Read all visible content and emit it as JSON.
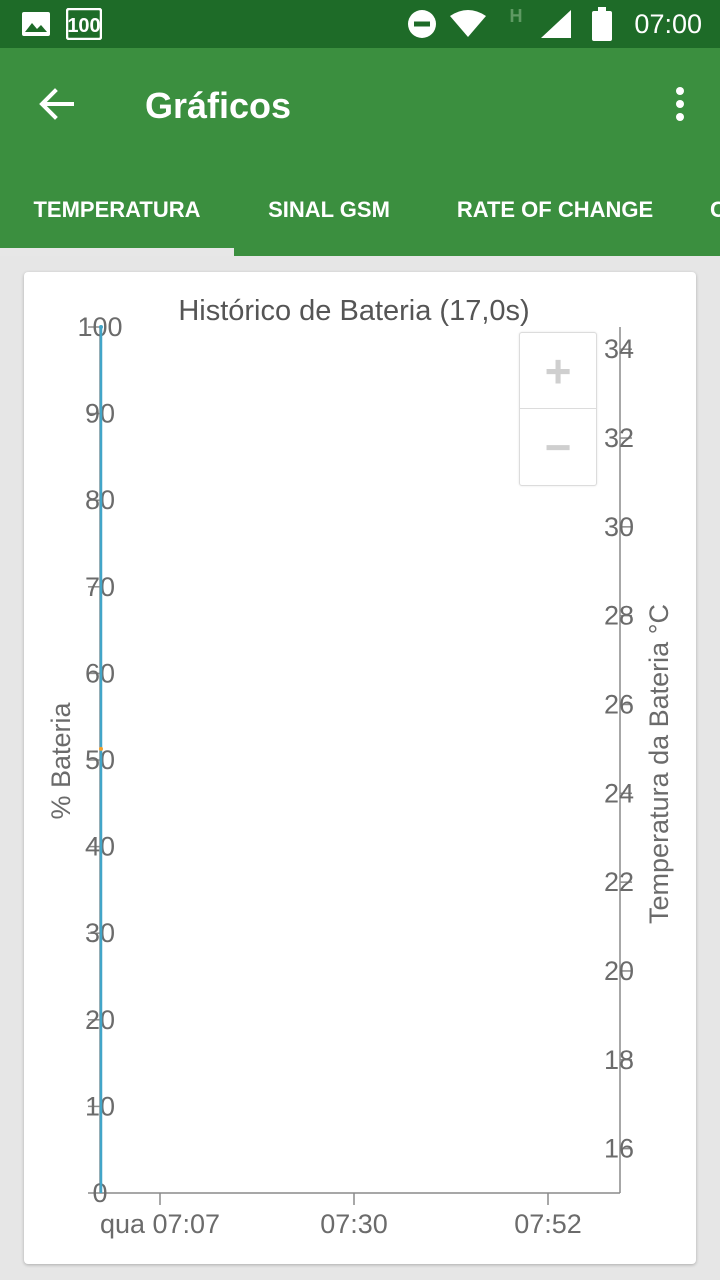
{
  "statusbar": {
    "time": "07:00",
    "badge": "100",
    "network_type": "H",
    "icons": [
      "image-icon",
      "badge-100-icon",
      "do-not-disturb-icon",
      "wifi-icon",
      "network-h-icon",
      "signal-icon",
      "battery-icon"
    ]
  },
  "appbar": {
    "title": "Gráficos",
    "back_icon": "arrow-back-icon",
    "menu_icon": "more-vert-icon"
  },
  "tabs": [
    {
      "label": "TEMPERATURA",
      "active": true
    },
    {
      "label": "SINAL GSM",
      "active": false
    },
    {
      "label": "RATE OF CHANGE",
      "active": false
    },
    {
      "label": "C",
      "active": false
    }
  ],
  "zoom": {
    "in_label": "+",
    "out_label": "−"
  },
  "colors": {
    "statusbar": "#1e6b28",
    "appbar": "#3b8f3f",
    "battery_series": "#42a5c8",
    "temperature_series": "#f0a030"
  },
  "chart_data": {
    "type": "line",
    "title": "Histórico de Bateria (17,0s)",
    "ylabel": "% Bateria",
    "y2label": "Temperatura da Bateria °C",
    "x_ticks": [
      "qua 07:07",
      "07:30",
      "07:52"
    ],
    "y_ticks": [
      "100",
      "90",
      "80",
      "70",
      "60",
      "50",
      "40",
      "30",
      "20",
      "10",
      "0"
    ],
    "y2_ticks": [
      "34",
      "32",
      "30",
      "28",
      "26",
      "24",
      "22",
      "20",
      "18",
      "16"
    ],
    "ylim": [
      0,
      100
    ],
    "y2lim": [
      15,
      34.5
    ],
    "series": [
      {
        "values": [
          100,
          100,
          0
        ],
        "color": "#42a5c8"
      },
      {
        "values": [
          25,
          25
        ],
        "color": "#f0a030"
      }
    ]
  }
}
